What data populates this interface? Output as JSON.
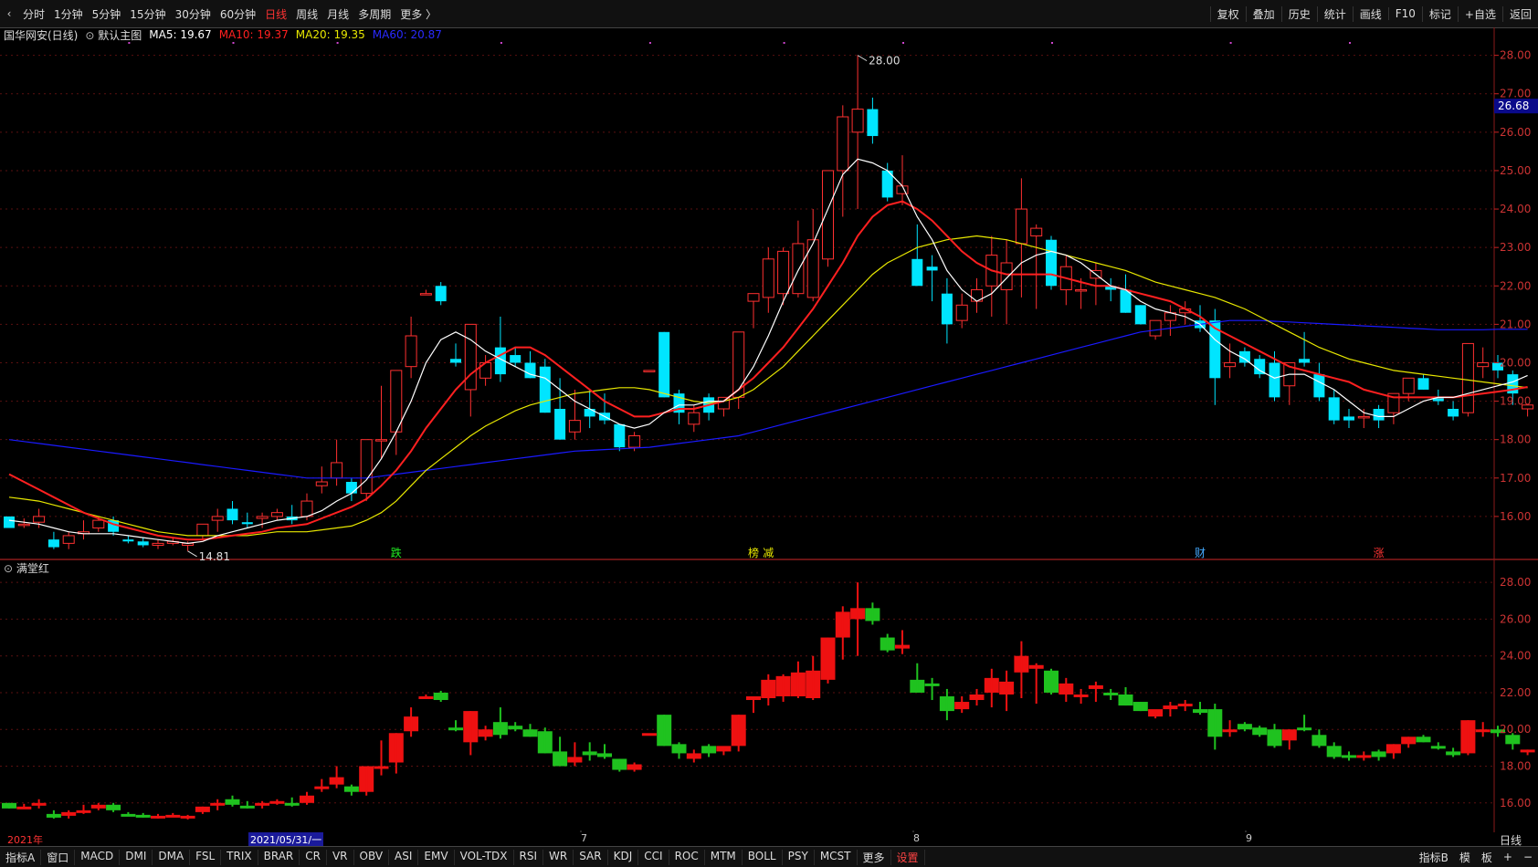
{
  "toolbar": {
    "back_label": "‹",
    "periods": [
      "分时",
      "1分钟",
      "5分钟",
      "15分钟",
      "30分钟",
      "60分钟",
      "日线",
      "周线",
      "月线",
      "多周期",
      "更多 〉"
    ],
    "active_period": "日线",
    "tools": [
      "复权",
      "叠加",
      "历史",
      "统计",
      "画线",
      "F10",
      "标记",
      "+自选",
      "返回"
    ]
  },
  "legend": {
    "stock": "国华网安(日线)",
    "template": "默认主图",
    "ma5": "MA5: 19.67",
    "ma10": "MA10: 19.37",
    "ma20": "MA20: 19.35",
    "ma60": "MA60: 20.87",
    "colors": {
      "ma5": "#ffffff",
      "ma10": "#ff2020",
      "ma20": "#e8e800",
      "ma60": "#1a1aff"
    }
  },
  "main_chart": {
    "high_label": "28.00",
    "low_label": "14.81",
    "price_tag": "26.68",
    "y_ticks": [
      "28.00",
      "27.00",
      "26.00",
      "25.00",
      "24.00",
      "23.00",
      "22.00",
      "21.00",
      "20.00",
      "19.00",
      "18.00",
      "17.00",
      "16.00"
    ],
    "markers": [
      "跌",
      "榜",
      "减",
      "财",
      "涨"
    ]
  },
  "sub_chart": {
    "name": "满堂红",
    "y_ticks": [
      "28.00",
      "26.00",
      "24.00",
      "22.00",
      "20.00",
      "18.00",
      "16.00"
    ]
  },
  "date_axis": {
    "year": "2021年",
    "selected": "2021/05/31/一",
    "months": [
      "7",
      "8",
      "9"
    ],
    "right_label": "日线"
  },
  "bottom": {
    "indicator_label": "指标A",
    "window_label": "窗口",
    "indicators": [
      "MACD",
      "DMI",
      "DMA",
      "FSL",
      "TRIX",
      "BRAR",
      "CR",
      "VR",
      "OBV",
      "ASI",
      "EMV",
      "VOL-TDX",
      "RSI",
      "WR",
      "SAR",
      "KDJ",
      "CCI",
      "ROC",
      "MTM",
      "BOLL",
      "PSY",
      "MCST",
      "更多"
    ],
    "settings_label": "设置",
    "right_items": [
      "指标B",
      "模",
      "板",
      "+",
      "−"
    ]
  },
  "chart_data": {
    "type": "candlestick",
    "title": "国华网安(日线)",
    "ylim_main": [
      15.0,
      28.3
    ],
    "ylim_sub": [
      14.5,
      29.0
    ],
    "candles": [
      [
        16.0,
        16.0,
        15.7,
        15.7
      ],
      [
        15.8,
        15.95,
        15.7,
        15.8
      ],
      [
        15.85,
        16.2,
        15.7,
        16.0
      ],
      [
        15.4,
        15.6,
        15.15,
        15.2
      ],
      [
        15.3,
        15.6,
        15.15,
        15.5
      ],
      [
        15.55,
        15.9,
        15.4,
        15.6
      ],
      [
        15.7,
        16.0,
        15.6,
        15.9
      ],
      [
        15.9,
        16.0,
        15.5,
        15.6
      ],
      [
        15.4,
        15.5,
        15.3,
        15.35
      ],
      [
        15.35,
        15.45,
        15.2,
        15.25
      ],
      [
        15.25,
        15.4,
        15.15,
        15.3
      ],
      [
        15.3,
        15.45,
        15.25,
        15.35
      ],
      [
        15.25,
        15.35,
        15.1,
        15.3
      ],
      [
        15.5,
        15.8,
        15.4,
        15.8
      ],
      [
        15.9,
        16.2,
        15.6,
        16.0
      ],
      [
        16.2,
        16.4,
        15.8,
        15.9
      ],
      [
        15.85,
        16.1,
        15.7,
        15.8
      ],
      [
        15.95,
        16.1,
        15.7,
        16.0
      ],
      [
        16.0,
        16.2,
        15.9,
        16.1
      ],
      [
        16.0,
        16.3,
        15.8,
        15.9
      ],
      [
        16.0,
        16.6,
        15.9,
        16.4
      ],
      [
        16.8,
        17.3,
        16.6,
        16.9
      ],
      [
        17.0,
        18.0,
        16.8,
        17.4
      ],
      [
        16.9,
        17.0,
        16.4,
        16.6
      ],
      [
        16.6,
        18.0,
        16.4,
        18.0
      ],
      [
        18.0,
        19.4,
        17.5,
        18.0
      ],
      [
        18.2,
        19.8,
        17.6,
        19.8
      ],
      [
        19.9,
        21.2,
        19.6,
        20.7
      ],
      [
        21.8,
        21.9,
        21.8,
        21.8
      ],
      [
        22.0,
        22.1,
        21.5,
        21.6
      ],
      [
        20.1,
        20.5,
        19.9,
        20.0
      ],
      [
        19.3,
        21.0,
        18.6,
        21.0
      ],
      [
        19.6,
        20.2,
        19.4,
        20.0
      ],
      [
        20.4,
        21.2,
        19.5,
        19.7
      ],
      [
        20.2,
        20.4,
        19.9,
        20.0
      ],
      [
        20.0,
        20.3,
        19.6,
        19.6
      ],
      [
        19.9,
        20.1,
        18.7,
        18.7
      ],
      [
        18.8,
        19.6,
        18.0,
        18.0
      ],
      [
        18.2,
        19.3,
        18.0,
        18.5
      ],
      [
        18.8,
        19.3,
        18.3,
        18.6
      ],
      [
        18.7,
        19.2,
        18.4,
        18.5
      ],
      [
        18.4,
        18.4,
        17.7,
        17.8
      ],
      [
        17.8,
        18.2,
        17.7,
        18.1
      ],
      [
        19.8,
        19.8,
        19.8,
        19.8
      ],
      [
        20.8,
        20.8,
        19.1,
        19.1
      ],
      [
        19.2,
        19.3,
        18.4,
        18.7
      ],
      [
        18.4,
        18.9,
        18.2,
        18.7
      ],
      [
        19.1,
        19.2,
        18.5,
        18.7
      ],
      [
        18.8,
        19.0,
        18.6,
        19.1
      ],
      [
        19.1,
        20.8,
        18.8,
        20.8
      ],
      [
        21.6,
        21.8,
        20.9,
        21.8
      ],
      [
        21.7,
        23.0,
        21.3,
        22.7
      ],
      [
        21.8,
        23.0,
        21.5,
        22.9
      ],
      [
        21.8,
        23.7,
        21.7,
        23.1
      ],
      [
        21.7,
        24.0,
        21.6,
        23.2
      ],
      [
        22.7,
        25.0,
        22.5,
        25.0
      ],
      [
        25.0,
        26.7,
        23.8,
        26.4
      ],
      [
        26.0,
        28.0,
        24.0,
        26.6
      ],
      [
        26.6,
        26.9,
        25.7,
        25.9
      ],
      [
        25.0,
        25.2,
        24.2,
        24.3
      ],
      [
        24.4,
        25.4,
        24.1,
        24.6
      ],
      [
        22.7,
        23.6,
        22.0,
        22.0
      ],
      [
        22.5,
        22.8,
        21.6,
        22.4
      ],
      [
        21.8,
        22.2,
        20.5,
        21.0
      ],
      [
        21.1,
        21.8,
        20.9,
        21.5
      ],
      [
        21.6,
        22.2,
        21.3,
        21.9
      ],
      [
        22.0,
        23.3,
        21.2,
        22.8
      ],
      [
        21.9,
        23.2,
        21.0,
        22.6
      ],
      [
        23.1,
        24.8,
        21.7,
        24.0
      ],
      [
        23.3,
        23.6,
        21.4,
        23.5
      ],
      [
        23.2,
        23.3,
        21.9,
        22.0
      ],
      [
        21.9,
        22.8,
        21.5,
        22.5
      ],
      [
        21.9,
        22.2,
        21.4,
        21.9
      ],
      [
        22.2,
        22.6,
        21.5,
        22.4
      ],
      [
        22.0,
        22.2,
        21.6,
        21.9
      ],
      [
        21.9,
        22.3,
        21.3,
        21.3
      ],
      [
        21.5,
        21.5,
        21.0,
        21.0
      ],
      [
        20.7,
        21.0,
        20.6,
        21.1
      ],
      [
        21.1,
        21.5,
        20.7,
        21.3
      ],
      [
        21.3,
        21.6,
        21.0,
        21.4
      ],
      [
        21.1,
        21.5,
        20.8,
        20.9
      ],
      [
        21.1,
        21.4,
        18.9,
        19.6
      ],
      [
        19.9,
        20.5,
        19.6,
        20.0
      ],
      [
        20.3,
        20.4,
        19.9,
        20.0
      ],
      [
        20.1,
        20.2,
        19.6,
        19.7
      ],
      [
        20.0,
        20.3,
        19.0,
        19.1
      ],
      [
        19.4,
        20.0,
        18.9,
        20.0
      ],
      [
        20.1,
        20.8,
        19.9,
        20.0
      ],
      [
        19.7,
        20.0,
        19.0,
        19.1
      ],
      [
        19.1,
        19.3,
        18.4,
        18.5
      ],
      [
        18.6,
        18.8,
        18.3,
        18.5
      ],
      [
        18.6,
        18.8,
        18.3,
        18.6
      ],
      [
        18.8,
        18.9,
        18.3,
        18.5
      ],
      [
        18.7,
        19.2,
        18.4,
        19.2
      ],
      [
        19.2,
        19.6,
        19.0,
        19.6
      ],
      [
        19.6,
        19.7,
        19.3,
        19.3
      ],
      [
        19.1,
        19.3,
        18.9,
        19.0
      ],
      [
        18.8,
        19.0,
        18.5,
        18.6
      ],
      [
        18.7,
        20.5,
        18.6,
        20.5
      ],
      [
        19.9,
        20.4,
        19.6,
        20.0
      ],
      [
        20.0,
        20.2,
        19.6,
        19.8
      ],
      [
        19.7,
        19.8,
        18.9,
        19.2
      ],
      [
        18.8,
        18.9,
        18.6,
        18.9
      ]
    ],
    "ma5": [
      15.9,
      15.85,
      15.8,
      15.7,
      15.6,
      15.55,
      15.55,
      15.55,
      15.5,
      15.45,
      15.4,
      15.35,
      15.3,
      15.35,
      15.5,
      15.6,
      15.7,
      15.8,
      15.9,
      15.95,
      16.0,
      16.15,
      16.4,
      16.6,
      16.95,
      17.5,
      18.2,
      19.0,
      20.0,
      20.6,
      20.8,
      20.6,
      20.3,
      20.1,
      19.9,
      19.7,
      19.6,
      19.3,
      19.0,
      18.8,
      18.6,
      18.4,
      18.3,
      18.4,
      18.7,
      18.9,
      18.9,
      19.0,
      19.0,
      19.3,
      19.9,
      20.7,
      21.6,
      22.4,
      23.1,
      24.0,
      24.9,
      25.3,
      25.2,
      25.0,
      24.6,
      23.8,
      23.2,
      22.4,
      21.9,
      21.6,
      21.8,
      22.2,
      22.6,
      22.8,
      22.9,
      22.8,
      22.6,
      22.3,
      22.0,
      21.9,
      21.6,
      21.4,
      21.3,
      21.2,
      21.0,
      20.6,
      20.3,
      20.1,
      19.8,
      19.6,
      19.7,
      19.7,
      19.5,
      19.3,
      19.0,
      18.7,
      18.6,
      18.6,
      18.8,
      19.0,
      19.1,
      19.1,
      19.2,
      19.3,
      19.4,
      19.5,
      19.67
    ],
    "ma10": [
      17.1,
      16.9,
      16.7,
      16.5,
      16.3,
      16.1,
      15.95,
      15.8,
      15.7,
      15.6,
      15.5,
      15.45,
      15.4,
      15.4,
      15.45,
      15.5,
      15.55,
      15.6,
      15.7,
      15.75,
      15.8,
      15.95,
      16.1,
      16.25,
      16.45,
      16.8,
      17.2,
      17.7,
      18.3,
      18.8,
      19.3,
      19.7,
      20.0,
      20.2,
      20.4,
      20.4,
      20.2,
      19.9,
      19.6,
      19.3,
      19.0,
      18.8,
      18.6,
      18.6,
      18.7,
      18.8,
      18.8,
      18.9,
      19.0,
      19.3,
      19.6,
      20.0,
      20.4,
      20.9,
      21.4,
      22.0,
      22.6,
      23.3,
      23.8,
      24.1,
      24.2,
      24.0,
      23.7,
      23.3,
      22.9,
      22.6,
      22.4,
      22.3,
      22.3,
      22.3,
      22.3,
      22.2,
      22.1,
      22.0,
      22.0,
      21.9,
      21.8,
      21.7,
      21.6,
      21.4,
      21.2,
      20.9,
      20.7,
      20.5,
      20.3,
      20.1,
      19.9,
      19.8,
      19.7,
      19.6,
      19.5,
      19.3,
      19.2,
      19.1,
      19.1,
      19.1,
      19.1,
      19.1,
      19.15,
      19.2,
      19.25,
      19.3,
      19.37
    ],
    "ma20": [
      16.5,
      16.45,
      16.4,
      16.3,
      16.2,
      16.1,
      16.0,
      15.9,
      15.8,
      15.7,
      15.6,
      15.55,
      15.5,
      15.5,
      15.5,
      15.5,
      15.5,
      15.55,
      15.6,
      15.6,
      15.6,
      15.65,
      15.7,
      15.75,
      15.9,
      16.1,
      16.4,
      16.8,
      17.2,
      17.5,
      17.8,
      18.1,
      18.35,
      18.55,
      18.75,
      18.9,
      19.0,
      19.1,
      19.2,
      19.25,
      19.3,
      19.35,
      19.35,
      19.3,
      19.2,
      19.1,
      19.0,
      18.95,
      19.0,
      19.1,
      19.3,
      19.6,
      19.9,
      20.3,
      20.7,
      21.1,
      21.5,
      21.9,
      22.3,
      22.6,
      22.8,
      23.0,
      23.1,
      23.2,
      23.25,
      23.3,
      23.25,
      23.2,
      23.1,
      23.0,
      22.9,
      22.8,
      22.7,
      22.6,
      22.5,
      22.4,
      22.25,
      22.1,
      22.0,
      21.9,
      21.8,
      21.7,
      21.55,
      21.4,
      21.2,
      21.0,
      20.8,
      20.6,
      20.4,
      20.25,
      20.1,
      20.0,
      19.9,
      19.8,
      19.75,
      19.7,
      19.65,
      19.6,
      19.55,
      19.5,
      19.45,
      19.4,
      19.35
    ],
    "ma60": [
      18.0,
      17.95,
      17.9,
      17.85,
      17.8,
      17.75,
      17.7,
      17.65,
      17.6,
      17.55,
      17.5,
      17.45,
      17.4,
      17.35,
      17.3,
      17.25,
      17.2,
      17.15,
      17.1,
      17.05,
      17.0,
      17.0,
      17.0,
      17.0,
      17.0,
      17.05,
      17.1,
      17.15,
      17.2,
      17.25,
      17.3,
      17.35,
      17.4,
      17.45,
      17.5,
      17.55,
      17.6,
      17.65,
      17.7,
      17.72,
      17.74,
      17.76,
      17.78,
      17.8,
      17.85,
      17.9,
      17.95,
      18.0,
      18.05,
      18.1,
      18.2,
      18.3,
      18.4,
      18.5,
      18.6,
      18.7,
      18.8,
      18.9,
      19.0,
      19.1,
      19.2,
      19.3,
      19.4,
      19.5,
      19.6,
      19.7,
      19.8,
      19.9,
      20.0,
      20.1,
      20.2,
      20.3,
      20.4,
      20.5,
      20.6,
      20.7,
      20.8,
      20.85,
      20.9,
      20.95,
      21.0,
      21.05,
      21.1,
      21.1,
      21.1,
      21.08,
      21.06,
      21.04,
      21.02,
      21.0,
      20.98,
      20.96,
      20.94,
      20.92,
      20.9,
      20.88,
      20.86,
      20.86,
      20.86,
      20.86,
      20.87,
      20.87,
      20.87
    ],
    "markers": [
      {
        "i": 26,
        "label": "跌",
        "color": "#22ee22"
      },
      {
        "i": 50,
        "label": "榜",
        "color": "#e8e800"
      },
      {
        "i": 51,
        "label": "减",
        "color": "#e8e800"
      },
      {
        "i": 80,
        "label": "财",
        "color": "#44aaff"
      },
      {
        "i": 92,
        "label": "涨",
        "color": "#ff3333"
      }
    ]
  }
}
